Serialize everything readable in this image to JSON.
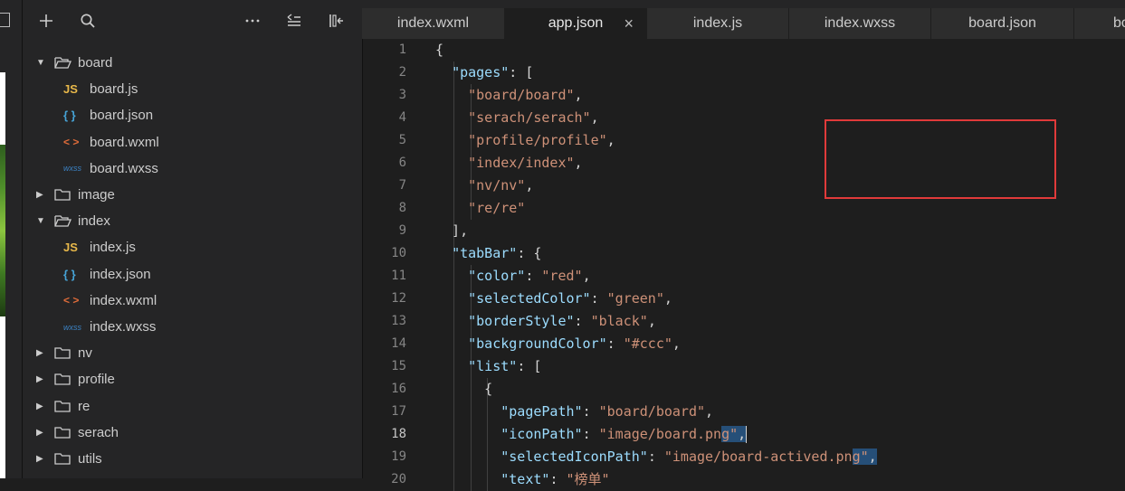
{
  "explorer": {
    "tree": [
      {
        "label": "board",
        "type": "folder",
        "expanded": true,
        "depth": 0
      },
      {
        "label": "board.js",
        "type": "file",
        "icon": "JS",
        "kind": "js",
        "depth": 1
      },
      {
        "label": "board.json",
        "type": "file",
        "icon": "{ }",
        "kind": "json",
        "depth": 1
      },
      {
        "label": "board.wxml",
        "type": "file",
        "icon": "< >",
        "kind": "wxml",
        "depth": 1
      },
      {
        "label": "board.wxss",
        "type": "file",
        "icon": "wxss",
        "kind": "wxss",
        "depth": 1
      },
      {
        "label": "image",
        "type": "folder",
        "expanded": false,
        "depth": 0
      },
      {
        "label": "index",
        "type": "folder",
        "expanded": true,
        "depth": 0
      },
      {
        "label": "index.js",
        "type": "file",
        "icon": "JS",
        "kind": "js",
        "depth": 1
      },
      {
        "label": "index.json",
        "type": "file",
        "icon": "{ }",
        "kind": "json",
        "depth": 1
      },
      {
        "label": "index.wxml",
        "type": "file",
        "icon": "< >",
        "kind": "wxml",
        "depth": 1
      },
      {
        "label": "index.wxss",
        "type": "file",
        "icon": "wxss",
        "kind": "wxss",
        "depth": 1
      },
      {
        "label": "nv",
        "type": "folder",
        "expanded": false,
        "depth": 0
      },
      {
        "label": "profile",
        "type": "folder",
        "expanded": false,
        "depth": 0
      },
      {
        "label": "re",
        "type": "folder",
        "expanded": false,
        "depth": 0
      },
      {
        "label": "serach",
        "type": "folder",
        "expanded": false,
        "depth": 0
      },
      {
        "label": "utils",
        "type": "folder",
        "expanded": false,
        "depth": 0
      }
    ]
  },
  "tabs": [
    {
      "label": "index.wxml",
      "active": false
    },
    {
      "label": "app.json",
      "active": true,
      "close": "×"
    },
    {
      "label": "index.js",
      "active": false
    },
    {
      "label": "index.wxss",
      "active": false
    },
    {
      "label": "board.json",
      "active": false
    },
    {
      "label": "boa",
      "active": false
    }
  ],
  "editor": {
    "current_line": 18,
    "lines": [
      {
        "n": "1",
        "tokens": [
          [
            "p",
            "{"
          ]
        ]
      },
      {
        "n": "2",
        "tokens": [
          [
            "p",
            "  "
          ],
          [
            "k",
            "\"pages\""
          ],
          [
            "p",
            ": ["
          ]
        ]
      },
      {
        "n": "3",
        "tokens": [
          [
            "p",
            "    "
          ],
          [
            "s",
            "\"board/board\""
          ],
          [
            "p",
            ","
          ]
        ]
      },
      {
        "n": "4",
        "tokens": [
          [
            "p",
            "    "
          ],
          [
            "s",
            "\"serach/serach\""
          ],
          [
            "p",
            ","
          ]
        ]
      },
      {
        "n": "5",
        "tokens": [
          [
            "p",
            "    "
          ],
          [
            "s",
            "\"profile/profile\""
          ],
          [
            "p",
            ","
          ]
        ]
      },
      {
        "n": "6",
        "tokens": [
          [
            "p",
            "    "
          ],
          [
            "s",
            "\"index/index\""
          ],
          [
            "p",
            ","
          ]
        ]
      },
      {
        "n": "7",
        "tokens": [
          [
            "p",
            "    "
          ],
          [
            "s",
            "\"nv/nv\""
          ],
          [
            "p",
            ","
          ]
        ]
      },
      {
        "n": "8",
        "tokens": [
          [
            "p",
            "    "
          ],
          [
            "s",
            "\"re/re\""
          ]
        ]
      },
      {
        "n": "9",
        "tokens": [
          [
            "p",
            "  ],"
          ]
        ]
      },
      {
        "n": "10",
        "tokens": [
          [
            "p",
            "  "
          ],
          [
            "k",
            "\"tabBar\""
          ],
          [
            "p",
            ": {"
          ]
        ]
      },
      {
        "n": "11",
        "tokens": [
          [
            "p",
            "    "
          ],
          [
            "k",
            "\"color\""
          ],
          [
            "p",
            ": "
          ],
          [
            "s",
            "\"red\""
          ],
          [
            "p",
            ","
          ]
        ]
      },
      {
        "n": "12",
        "tokens": [
          [
            "p",
            "    "
          ],
          [
            "k",
            "\"selectedColor\""
          ],
          [
            "p",
            ": "
          ],
          [
            "s",
            "\"green\""
          ],
          [
            "p",
            ","
          ]
        ]
      },
      {
        "n": "13",
        "tokens": [
          [
            "p",
            "    "
          ],
          [
            "k",
            "\"borderStyle\""
          ],
          [
            "p",
            ": "
          ],
          [
            "s",
            "\"black\""
          ],
          [
            "p",
            ","
          ]
        ]
      },
      {
        "n": "14",
        "tokens": [
          [
            "p",
            "    "
          ],
          [
            "k",
            "\"backgroundColor\""
          ],
          [
            "p",
            ": "
          ],
          [
            "s",
            "\"#ccc\""
          ],
          [
            "p",
            ","
          ]
        ]
      },
      {
        "n": "15",
        "tokens": [
          [
            "p",
            "    "
          ],
          [
            "k",
            "\"list\""
          ],
          [
            "p",
            ": ["
          ]
        ]
      },
      {
        "n": "16",
        "tokens": [
          [
            "p",
            "      {"
          ]
        ]
      },
      {
        "n": "17",
        "tokens": [
          [
            "p",
            "        "
          ],
          [
            "k",
            "\"pagePath\""
          ],
          [
            "p",
            ": "
          ],
          [
            "s",
            "\"board/board\""
          ],
          [
            "p",
            ","
          ]
        ]
      },
      {
        "n": "18",
        "tokens": [
          [
            "p",
            "        "
          ],
          [
            "k",
            "\"iconPath\""
          ],
          [
            "p",
            ": "
          ],
          [
            "s",
            "\"image/board.pn"
          ],
          [
            "sel-s",
            "g\""
          ],
          [
            "sel-p",
            ","
          ],
          [
            "cursor",
            ""
          ]
        ]
      },
      {
        "n": "19",
        "tokens": [
          [
            "p",
            "        "
          ],
          [
            "k",
            "\"selectedIconPath\""
          ],
          [
            "p",
            ": "
          ],
          [
            "s",
            "\"image/board-actived.pn"
          ],
          [
            "sel-s",
            "g\""
          ],
          [
            "sel-p",
            ","
          ]
        ]
      },
      {
        "n": "20",
        "tokens": [
          [
            "p",
            "        "
          ],
          [
            "k",
            "\"text\""
          ],
          [
            "p",
            ": "
          ],
          [
            "s",
            "\"榜单\""
          ]
        ]
      }
    ]
  },
  "colors": {
    "key": "#9cdcfe",
    "string": "#ce9178",
    "highlight_box": "#e03a3a",
    "background": "#1e1e1e"
  }
}
